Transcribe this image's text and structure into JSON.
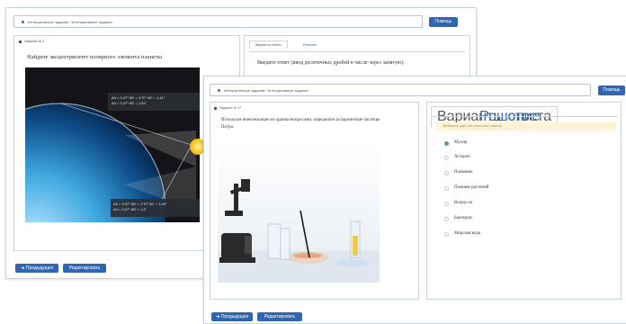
{
  "back": {
    "breadcrumb": "Интерактивные задания / Интерактивные задания",
    "next_button": "Помощь",
    "task_title": "Задание № 4",
    "question": "Найдите эксцентриситет полярного элемента планеты",
    "overlay_top_lines": [
      "A4 = 0,47°·85' = 1°27'·60' = 1,41°",
      "A4 = 0,47°·85' = 1,61°"
    ],
    "overlay_bottom_lines": [
      "A4 = 0,47°·85' = 1°27'·60' = 1,40°",
      "A4 = 0,47°·85' = 1,4°"
    ],
    "tabs": [
      "Варианты ответа",
      "Решение"
    ],
    "answer_prompt": "Введите ответ (ввод десятичных дробей в числе через запятую).",
    "prev_button": "◄ Предыдущее",
    "edit_button": "Редактировать"
  },
  "front": {
    "breadcrumb": "Интерактивные задания / Интерактивные задания",
    "help_button": "Помощь",
    "task_title": "Задание № 17",
    "question": "Используя нижележащие из хранки вопросами, определите аспаразитные частицы Петра.",
    "tabs": [
      "Варианты ответа",
      "Решение"
    ],
    "hint": "Выберите один или несколько ответов",
    "options": [
      "Мухир",
      "Астероп",
      "Плевание",
      "Помним растений",
      "Волрусло",
      "Бактерии",
      "Морская вода"
    ],
    "selected_index": 0,
    "prev_button": "◄ Предыдущее",
    "edit_button": "Редактировать"
  },
  "colors": {
    "accent": "#2f66b3",
    "selected": "#4caf50",
    "hint_bg": "#fdf3d9"
  }
}
